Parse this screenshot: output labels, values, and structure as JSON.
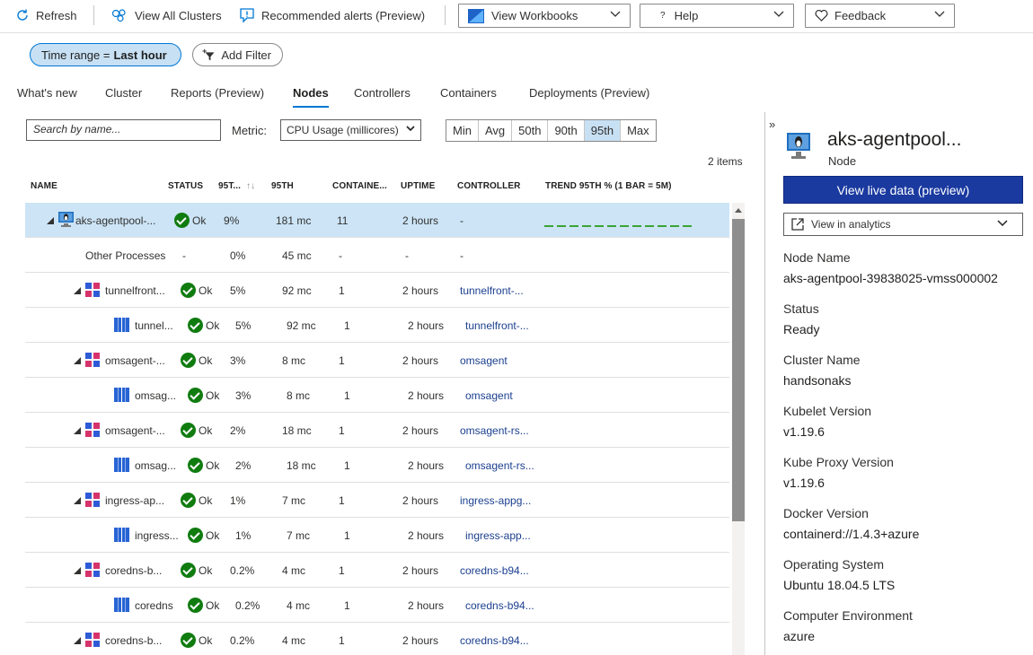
{
  "toolbar": {
    "refresh": "Refresh",
    "view_all_clusters": "View All Clusters",
    "recommended_alerts": "Recommended alerts (Preview)",
    "view_workbooks": "View Workbooks",
    "help": "Help",
    "feedback": "Feedback"
  },
  "filters": {
    "time_range_prefix": "Time range = ",
    "time_range_value": "Last hour",
    "add_filter": "Add Filter"
  },
  "tabs": [
    "What's new",
    "Cluster",
    "Reports (Preview)",
    "Nodes",
    "Controllers",
    "Containers",
    "Deployments (Preview)"
  ],
  "active_tab": "Nodes",
  "search": {
    "placeholder": "Search by name..."
  },
  "metric": {
    "label": "Metric:",
    "value": "CPU Usage (millicores)"
  },
  "percentiles": [
    "Min",
    "Avg",
    "50th",
    "90th",
    "95th",
    "Max"
  ],
  "selected_percentile": "95th",
  "items_count": "2 items",
  "columns": {
    "name": "NAME",
    "status": "STATUS",
    "p95pct": "95T...",
    "p95": "95TH",
    "containers": "CONTAINE...",
    "uptime": "UPTIME",
    "controller": "CONTROLLER",
    "trend": "TREND 95TH % (1 BAR = 5M)"
  },
  "rows": [
    {
      "type": "node",
      "name": "aks-agentpool-...",
      "status": "Ok",
      "pct": "9%",
      "p95": "181 mc",
      "containers": "11",
      "uptime": "2 hours",
      "controller": "-"
    },
    {
      "type": "other",
      "name": "Other Processes",
      "status": "-",
      "pct": "0%",
      "p95": "45 mc",
      "containers": "-",
      "uptime": "-",
      "controller": "-"
    },
    {
      "type": "pod",
      "name": "tunnelfront...",
      "status": "Ok",
      "pct": "5%",
      "p95": "92 mc",
      "containers": "1",
      "uptime": "2 hours",
      "controller": "tunnelfront-..."
    },
    {
      "type": "container",
      "name": "tunnel...",
      "status": "Ok",
      "pct": "5%",
      "p95": "92 mc",
      "containers": "1",
      "uptime": "2 hours",
      "controller": "tunnelfront-..."
    },
    {
      "type": "pod",
      "name": "omsagent-...",
      "status": "Ok",
      "pct": "3%",
      "p95": "8 mc",
      "containers": "1",
      "uptime": "2 hours",
      "controller": "omsagent"
    },
    {
      "type": "container",
      "name": "omsag...",
      "status": "Ok",
      "pct": "3%",
      "p95": "8 mc",
      "containers": "1",
      "uptime": "2 hours",
      "controller": "omsagent"
    },
    {
      "type": "pod",
      "name": "omsagent-...",
      "status": "Ok",
      "pct": "2%",
      "p95": "18 mc",
      "containers": "1",
      "uptime": "2 hours",
      "controller": "omsagent-rs..."
    },
    {
      "type": "container",
      "name": "omsag...",
      "status": "Ok",
      "pct": "2%",
      "p95": "18 mc",
      "containers": "1",
      "uptime": "2 hours",
      "controller": "omsagent-rs..."
    },
    {
      "type": "pod",
      "name": "ingress-ap...",
      "status": "Ok",
      "pct": "1%",
      "p95": "7 mc",
      "containers": "1",
      "uptime": "2 hours",
      "controller": "ingress-appg..."
    },
    {
      "type": "container",
      "name": "ingress...",
      "status": "Ok",
      "pct": "1%",
      "p95": "7 mc",
      "containers": "1",
      "uptime": "2 hours",
      "controller": "ingress-app..."
    },
    {
      "type": "pod",
      "name": "coredns-b...",
      "status": "Ok",
      "pct": "0.2%",
      "p95": "4 mc",
      "containers": "1",
      "uptime": "2 hours",
      "controller": "coredns-b94..."
    },
    {
      "type": "container",
      "name": "coredns",
      "status": "Ok",
      "pct": "0.2%",
      "p95": "4 mc",
      "containers": "1",
      "uptime": "2 hours",
      "controller": "coredns-b94..."
    },
    {
      "type": "pod",
      "name": "coredns-b...",
      "status": "Ok",
      "pct": "0.2%",
      "p95": "4 mc",
      "containers": "1",
      "uptime": "2 hours",
      "controller": "coredns-b94..."
    }
  ],
  "pane": {
    "collapse": "»",
    "title": "aks-agentpool...",
    "subtitle": "Node",
    "live_button": "View live data (preview)",
    "analytics": "View in analytics",
    "properties": [
      {
        "label": "Node Name",
        "value": "aks-agentpool-39838025-vmss000002"
      },
      {
        "label": "Status",
        "value": "Ready"
      },
      {
        "label": "Cluster Name",
        "value": "handsonaks"
      },
      {
        "label": "Kubelet Version",
        "value": "v1.19.6"
      },
      {
        "label": "Kube Proxy Version",
        "value": "v1.19.6"
      },
      {
        "label": "Docker Version",
        "value": "containerd://1.4.3+azure"
      },
      {
        "label": "Operating System",
        "value": "Ubuntu 18.04.5 LTS"
      },
      {
        "label": "Computer Environment",
        "value": "azure"
      }
    ]
  },
  "colors": {
    "accent": "#0078d4",
    "ok": "#107c10",
    "selected_row": "#cce4f6",
    "primary_button": "#1a3aa0",
    "link": "#1b3f8f"
  }
}
